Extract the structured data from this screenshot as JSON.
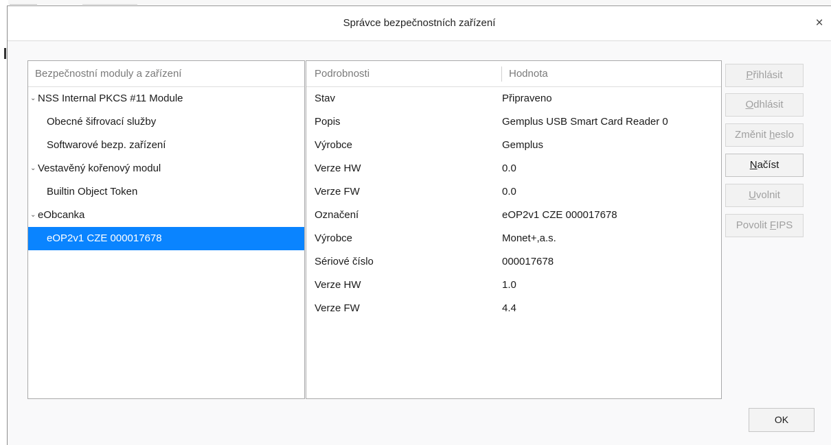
{
  "dialog": {
    "title": "Správce bezpečnostních zařízení",
    "close_glyph": "×"
  },
  "modules_panel": {
    "header": "Bezpečnostní moduly a zařízení",
    "items": [
      {
        "label": "NSS Internal PKCS #11 Module",
        "level": 0,
        "expanded": true
      },
      {
        "label": "Obecné šifrovací služby",
        "level": 1
      },
      {
        "label": "Softwarové bezp. zařízení",
        "level": 1
      },
      {
        "label": "Vestavěný kořenový modul",
        "level": 0,
        "expanded": true
      },
      {
        "label": "Builtin Object Token",
        "level": 1
      },
      {
        "label": "eObcanka",
        "level": 0,
        "expanded": true
      },
      {
        "label": "eOP2v1 CZE 000017678",
        "level": 1,
        "selected": true
      }
    ],
    "twisty_glyph": "⌄"
  },
  "details_panel": {
    "col_details": "Podrobnosti",
    "col_value": "Hodnota",
    "rows": [
      {
        "key": "Stav",
        "value": "Připraveno"
      },
      {
        "key": "Popis",
        "value": "Gemplus USB Smart Card Reader 0"
      },
      {
        "key": "Výrobce",
        "value": "Gemplus"
      },
      {
        "key": "Verze HW",
        "value": "0.0"
      },
      {
        "key": "Verze FW",
        "value": "0.0"
      },
      {
        "key": "Označení",
        "value": "eOP2v1 CZE 000017678"
      },
      {
        "key": "Výrobce",
        "value": "Monet+,a.s."
      },
      {
        "key": "Sériové číslo",
        "value": "000017678"
      },
      {
        "key": "Verze HW",
        "value": "1.0"
      },
      {
        "key": "Verze FW",
        "value": "4.4"
      }
    ]
  },
  "buttons": {
    "login": {
      "pre": "",
      "key": "P",
      "post": "řihlásit"
    },
    "logout": {
      "pre": "",
      "key": "O",
      "post": "dhlásit"
    },
    "change_password": {
      "pre": "Změnit ",
      "key": "h",
      "post": "eslo"
    },
    "load": {
      "pre": "",
      "key": "N",
      "post": "ačíst"
    },
    "unload": {
      "pre": "",
      "key": "U",
      "post": "volnit"
    },
    "enable_fips": {
      "pre": "Povolit ",
      "key": "F",
      "post": "IPS"
    },
    "ok": "OK"
  },
  "colors": {
    "selection": "#0a84ff",
    "disabled_text": "#a0a0a0"
  }
}
